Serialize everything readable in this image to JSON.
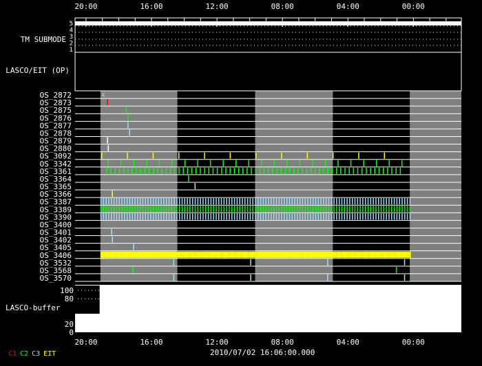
{
  "chart_data": {
    "type": "timeline",
    "time_ticks": [
      "20:00",
      "16:00",
      "12:00",
      "08:00",
      "04:00",
      "00:00"
    ],
    "time_range_hours_from_left": [
      0,
      23.6
    ],
    "tick_hours_from_left": [
      0.67,
      4.67,
      8.67,
      12.67,
      16.67,
      20.67
    ],
    "date_label": "2010/07/02 16:06:00.000",
    "tm_submode": {
      "label": "TM SUBMODE",
      "levels": [
        "5",
        "4",
        "3",
        "2",
        "1"
      ],
      "value": 5
    },
    "lasco_eit_label": "LASCO/EIT (OP)",
    "gray_bands_hours": [
      [
        1.55,
        6.25
      ],
      [
        11.0,
        15.75
      ],
      [
        20.45,
        23.6
      ]
    ],
    "rows": [
      "OS_2872",
      "OS_2873",
      "OS_2875",
      "OS_2876",
      "OS_2877",
      "OS_2878",
      "OS_2879",
      "OS_2880",
      "OS_3092",
      "OS_3342",
      "OS_3361",
      "OS_3364",
      "OS_3365",
      "OS_3366",
      "OS_3387",
      "OS_3389",
      "OS_3390",
      "OS_3400",
      "OS_3401",
      "OS_3402",
      "OS_3405",
      "OS_3406",
      "OS_3532",
      "OS_3568",
      "OS_3570"
    ],
    "events": [
      {
        "row": "OS_2873",
        "h": [
          1.95
        ],
        "c": "C1"
      },
      {
        "row": "OS_2875",
        "h": [
          3.1
        ],
        "c": "C2"
      },
      {
        "row": "OS_2876",
        "h": [
          3.2
        ],
        "c": "C2"
      },
      {
        "row": "OS_2877",
        "h": [
          3.2
        ],
        "c": "C3"
      },
      {
        "row": "OS_2878",
        "h": [
          3.3
        ],
        "c": "C3"
      },
      {
        "row": "OS_2879",
        "h": [
          1.95
        ],
        "c": "WHITE"
      },
      {
        "row": "OS_2880",
        "h": [
          2.0
        ],
        "c": "WHITE"
      },
      {
        "row": "OS_3364",
        "h": [
          6.9
        ],
        "c": "C2"
      },
      {
        "row": "OS_3365",
        "h": [
          7.3
        ],
        "c": "C3"
      },
      {
        "row": "OS_3366",
        "h": [
          2.25
        ],
        "c": "EIT"
      },
      {
        "row": "OS_3401",
        "h": [
          2.2
        ],
        "c": "C3"
      },
      {
        "row": "OS_3402",
        "h": [
          2.25
        ],
        "c": "C3"
      },
      {
        "row": "OS_3405",
        "h": [
          3.55
        ],
        "c": "C3"
      },
      {
        "row": "OS_3532",
        "h": [
          6.0,
          10.7,
          15.4,
          20.1
        ],
        "c": "C3"
      },
      {
        "row": "OS_3568",
        "h": [
          3.5,
          19.6
        ],
        "c": "C2"
      },
      {
        "row": "OS_3570",
        "h": [
          6.0,
          10.7,
          15.4,
          20.1
        ],
        "c": "C3"
      }
    ],
    "dense_rows": [
      {
        "row": "OS_3092",
        "start": 1.6,
        "end": 20.1,
        "step": 1.57,
        "c": "EIT"
      },
      {
        "row": "OS_3342",
        "start": 2.0,
        "end": 20.1,
        "step": 0.78,
        "c": "C2"
      },
      {
        "row": "OS_3361",
        "start": 1.9,
        "end": 20.1,
        "step": 0.26,
        "c": "C2"
      },
      {
        "row": "OS_3387",
        "start": 1.55,
        "end": 20.45,
        "step": 0.16,
        "c": "C3"
      },
      {
        "row": "OS_3389",
        "start": 1.55,
        "end": 20.45,
        "step": 0.16,
        "c": "C2"
      },
      {
        "row": "OS_3390",
        "start": 1.55,
        "end": 20.45,
        "step": 0.16,
        "c": "C3"
      },
      {
        "row": "OS_3406",
        "start": 1.55,
        "end": 20.45,
        "step": 0.08,
        "c": "EIT"
      }
    ],
    "buffer": {
      "label": "LASCO-buffer",
      "ticks": [
        "100",
        "80",
        "20",
        "0"
      ],
      "ylim": [
        0,
        100
      ]
    },
    "legend": [
      {
        "name": "C1",
        "color": "#ff0000"
      },
      {
        "name": "C2",
        "color": "#00ff00"
      },
      {
        "name": "C3",
        "color": "#a0e0ff"
      },
      {
        "name": "EIT",
        "color": "#ffff00"
      }
    ],
    "marker_label": "c"
  }
}
